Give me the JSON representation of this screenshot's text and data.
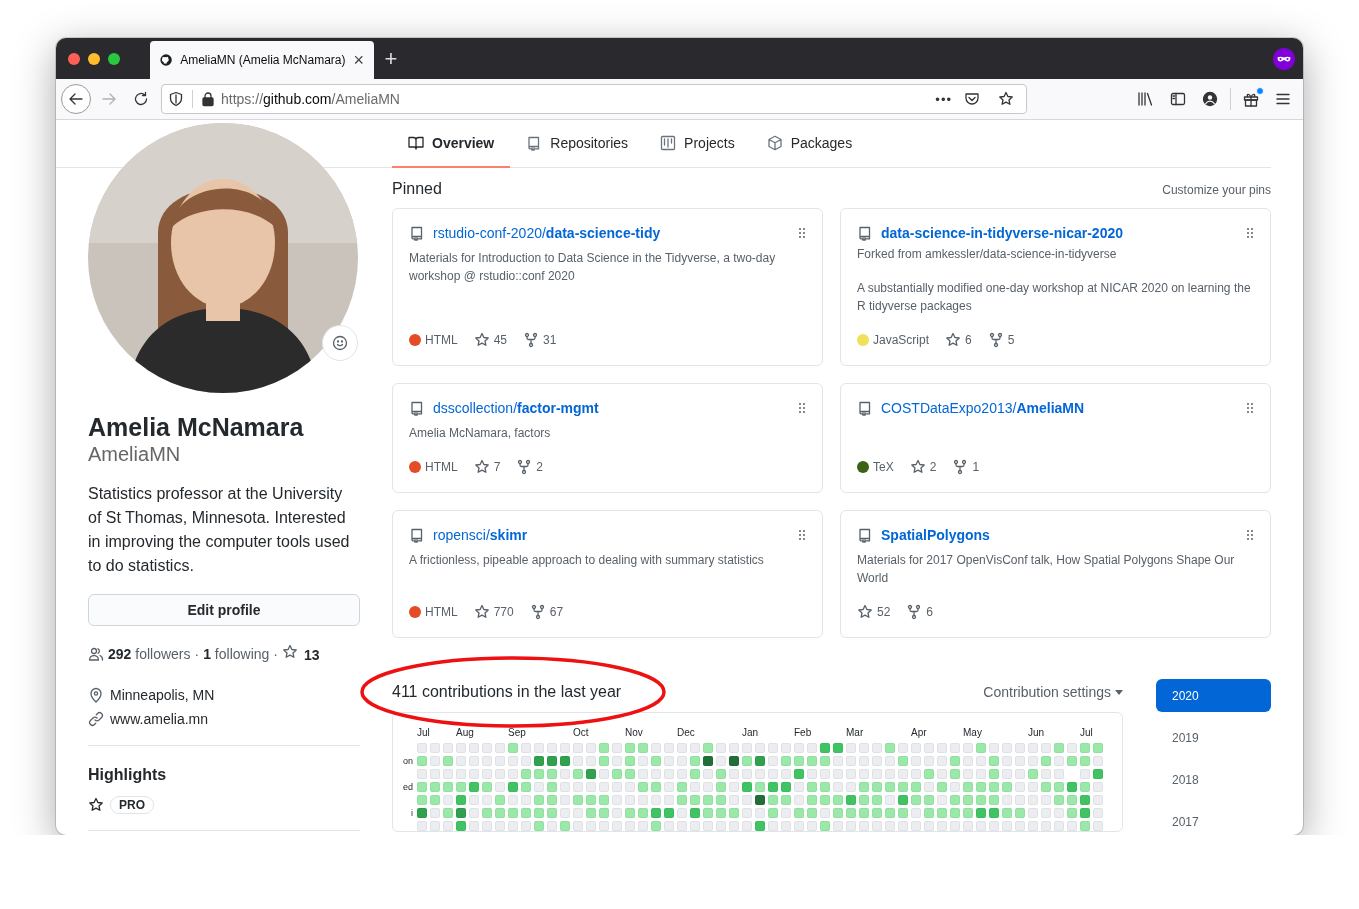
{
  "browser": {
    "tab": {
      "title": "AmeliaMN (Amelia McNamara)",
      "close": "×",
      "selected": true
    },
    "new_tab": "+",
    "forward_disabled": true,
    "url": {
      "scheme": "https://",
      "domain": "github.com",
      "path": "/AmeliaMN"
    },
    "page_actions": "•••",
    "gift_badge": true
  },
  "nav": {
    "tabs": [
      {
        "label": "Overview",
        "selected": true
      },
      {
        "label": "Repositories",
        "selected": false
      },
      {
        "label": "Projects",
        "selected": false
      },
      {
        "label": "Packages",
        "selected": false
      }
    ]
  },
  "profile": {
    "name": "Amelia McNamara",
    "username": "AmeliaMN",
    "bio": "Statistics professor at the University of St Thomas, Minnesota. Interested in improving the computer tools used to do statistics.",
    "edit_button": "Edit profile",
    "stats": {
      "followers": {
        "count": "292",
        "label": "followers"
      },
      "separator_1": "·",
      "following": {
        "count": "1",
        "label": "following"
      },
      "separator_2": "·",
      "stars": "13"
    },
    "location": "Minneapolis, MN",
    "website": "www.amelia.mn",
    "highlights": {
      "title": "Highlights",
      "badge": "PRO"
    }
  },
  "pinned": {
    "title": "Pinned",
    "customize": "Customize your pins",
    "cards": [
      {
        "owner": "rstudio-conf-2020/",
        "name": "data-science-tidy",
        "description": "Materials for Introduction to Data Science in the Tidyverse, a two-day workshop @ rstudio::conf 2020",
        "language": {
          "name": "HTML",
          "color": "#e34c26"
        },
        "stars": "45",
        "forks": "31"
      },
      {
        "name": "data-science-in-tidyverse-nicar-2020",
        "forked_from": "Forked from amkessler/data-science-in-tidyverse",
        "description": "A substantially modified one-day workshop at NICAR 2020 on learning the R tidyverse packages",
        "language": {
          "name": "JavaScript",
          "color": "#f1e05a"
        },
        "stars": "6",
        "forks": "5"
      },
      {
        "owner": "dsscollection/",
        "name": "factor-mgmt",
        "description": "Amelia McNamara, factors",
        "language": {
          "name": "HTML",
          "color": "#e34c26"
        },
        "stars": "7",
        "forks": "2"
      },
      {
        "owner": "COSTDataExpo2013/",
        "name": "AmeliaMN",
        "language": {
          "name": "TeX",
          "color": "#3d6117"
        },
        "stars": "2",
        "forks": "1"
      },
      {
        "owner": "ropensci/",
        "name": "skimr",
        "description": "A frictionless, pipeable approach to dealing with summary statistics",
        "language": {
          "name": "HTML",
          "color": "#e34c26"
        },
        "stars": "770",
        "forks": "67"
      },
      {
        "name": "SpatialPolygons",
        "description": "Materials for 2017 OpenVisConf talk, How Spatial Polygons Shape Our World",
        "stars": "52",
        "forks": "6"
      }
    ]
  },
  "contributions": {
    "summary": "411 contributions in the last year",
    "settings": "Contribution settings",
    "annotation": {
      "kind": "ellipse"
    },
    "months": [
      "Jul",
      "Aug",
      "Sep",
      "Oct",
      "Nov",
      "Dec",
      "Jan",
      "Feb",
      "Mar",
      "Apr",
      "May",
      "Jun",
      "Jul"
    ],
    "days": [
      "on",
      "ed",
      "i"
    ]
  },
  "years": [
    {
      "label": "2020",
      "selected": true
    },
    {
      "label": "2019",
      "selected": false
    },
    {
      "label": "2018",
      "selected": false
    },
    {
      "label": "2017",
      "selected": false
    }
  ]
}
